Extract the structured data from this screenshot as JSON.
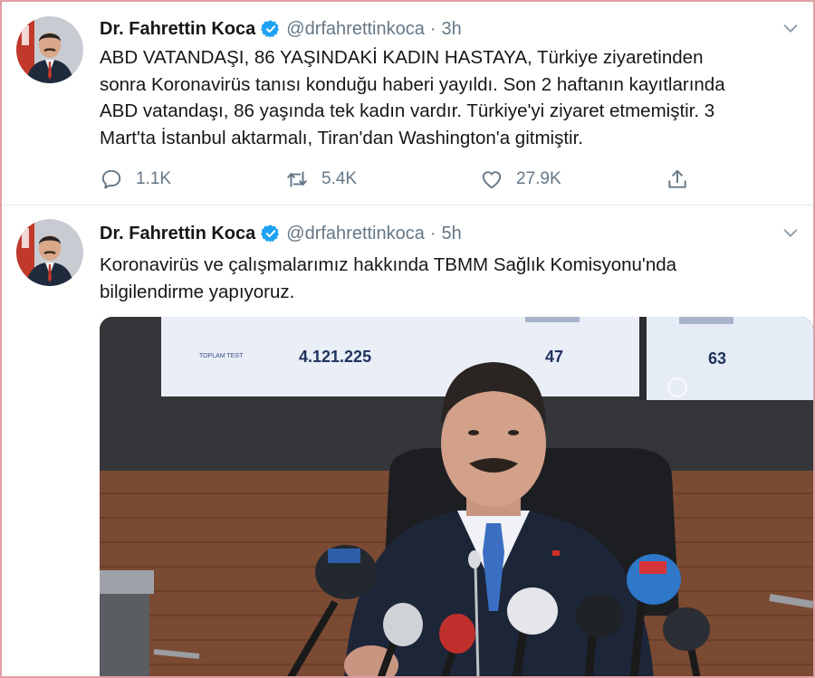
{
  "tweets": [
    {
      "author": "Dr. Fahrettin Koca",
      "handle": "@drfahrettinkoca",
      "separator": "·",
      "time": "3h",
      "text_lines": [
        "ABD VATANDAŞI, 86 YAŞINDAKİ KADIN HASTAYA, Türkiye ziyaretinden",
        "sonra Koronavirüs tanısı konduğu haberi yayıldı. Son 2 haftanın kayıtlarında",
        "ABD vatandaşı, 86 yaşında tek kadın vardır. Türkiye'yi ziyaret etmemiştir. 3",
        "Mart'ta İstanbul aktarmalı, Tiran'dan Washington'a gitmiştir."
      ],
      "replies": "1.1K",
      "retweets": "5.4K",
      "likes": "27.9K",
      "icons": [
        "reply-icon",
        "retweet-icon",
        "like-icon",
        "share-icon",
        "verified-badge-icon",
        "chevron-down-icon"
      ]
    },
    {
      "author": "Dr. Fahrettin Koca",
      "handle": "@drfahrettinkoca",
      "separator": "·",
      "time": "5h",
      "text_lines": [
        "Koronavirüs ve çalışmalarımız hakkında TBMM Sağlık Komisyonu'nda",
        "bilgilendirme yapıyoruz."
      ],
      "media": {
        "screen_numbers": [
          "4.121.225",
          "47",
          "63"
        ]
      }
    }
  ],
  "colors": {
    "text": "#14171a",
    "muted": "#657786",
    "verified": "#1da1f2",
    "frame": "#e0a0a6",
    "divider": "#e6ecf0"
  }
}
